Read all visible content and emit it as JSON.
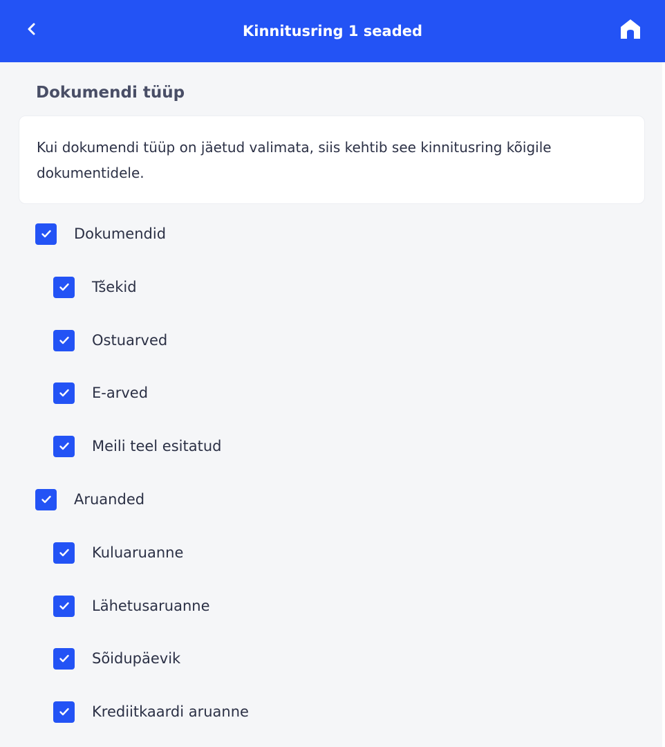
{
  "header": {
    "title": "Kinnitusring 1 seaded",
    "back_icon": "chevron-left-icon",
    "home_icon": "home-icon",
    "background_color": "#2353f5"
  },
  "document_type": {
    "section_title": "Dokumendi tüüp",
    "info_text": "Kui dokumendi tüüp on jäetud valimata, siis kehtib see kinnitusring kõigile dokumentidele."
  },
  "checklist": [
    {
      "label": "Dokumendid",
      "checked": true,
      "level": 0
    },
    {
      "label": "Tšekid",
      "checked": true,
      "level": 1
    },
    {
      "label": "Ostuarved",
      "checked": true,
      "level": 1
    },
    {
      "label": "E-arved",
      "checked": true,
      "level": 1
    },
    {
      "label": "Meili teel esitatud",
      "checked": true,
      "level": 1
    },
    {
      "label": "Aruanded",
      "checked": true,
      "level": 0
    },
    {
      "label": "Kuluaruanne",
      "checked": true,
      "level": 1
    },
    {
      "label": "Lähetusaruanne",
      "checked": true,
      "level": 1
    },
    {
      "label": "Sõidupäevik",
      "checked": true,
      "level": 1
    },
    {
      "label": "Krediitkaardi aruanne",
      "checked": true,
      "level": 1
    }
  ]
}
